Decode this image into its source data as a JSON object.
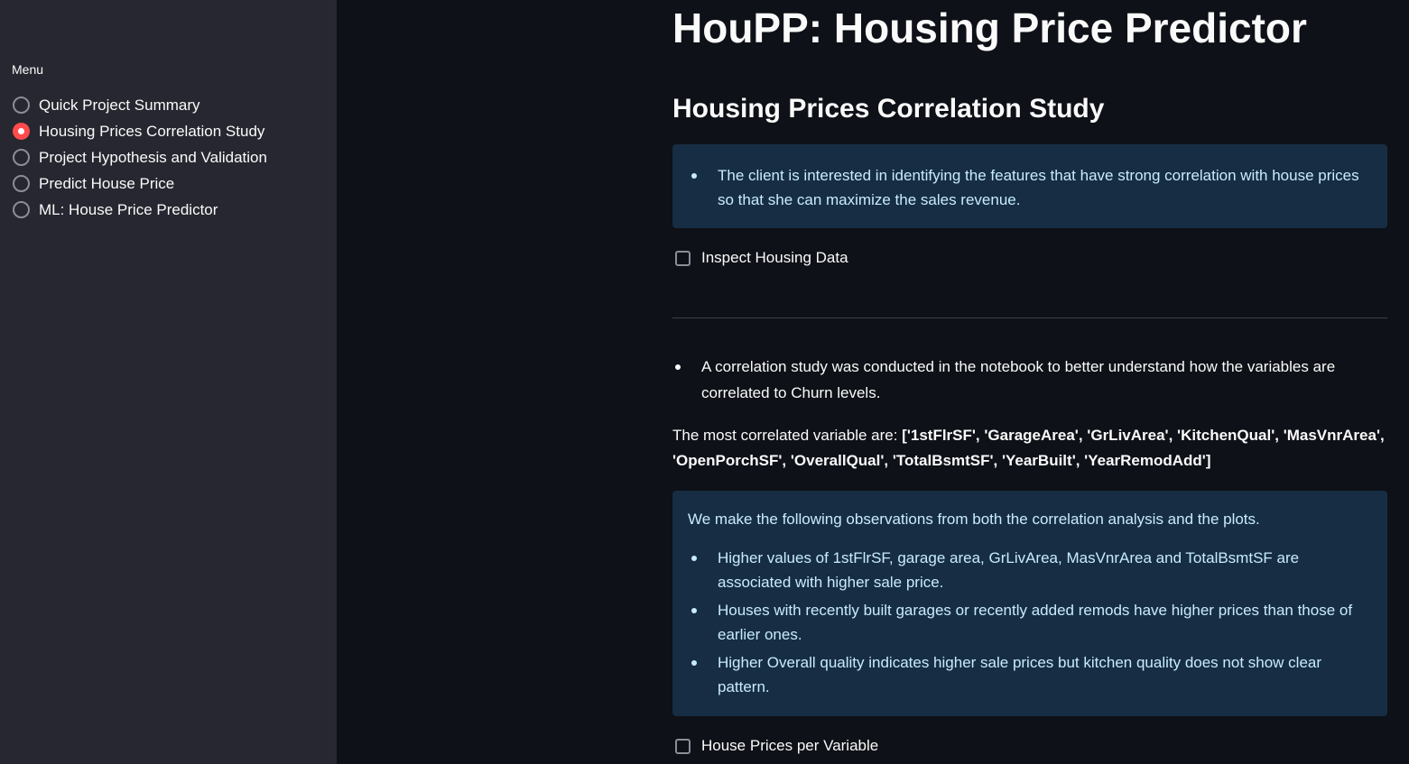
{
  "sidebar": {
    "menu_label": "Menu",
    "items": [
      {
        "label": "Quick Project Summary",
        "selected": false
      },
      {
        "label": "Housing Prices Correlation Study",
        "selected": true
      },
      {
        "label": "Project Hypothesis and Validation",
        "selected": false
      },
      {
        "label": "Predict House Price",
        "selected": false
      },
      {
        "label": "ML: House Price Predictor",
        "selected": false
      }
    ]
  },
  "main": {
    "title": "HouPP: Housing Price Predictor",
    "subtitle": "Housing Prices Correlation Study",
    "client_info": "The client is interested in identifying the features that have strong correlation with house prices so that she can maximize the sales revenue.",
    "inspect_checkbox_label": "Inspect Housing Data",
    "inspect_checked": false,
    "study_bullet": "A correlation study was conducted in the notebook to better understand how the variables are correlated to Churn levels.",
    "corr_prefix": "The most correlated variable are: ",
    "corr_variables": "['1stFlrSF', 'GarageArea', 'GrLivArea', 'KitchenQual', 'MasVnrArea', 'OpenPorchSF', 'OverallQual', 'TotalBsmtSF', 'YearBuilt', 'YearRemodAdd']",
    "observations_intro": "We make the following observations from both the correlation analysis and the plots.",
    "observations": [
      "Higher values of 1stFlrSF, garage area, GrLivArea, MasVnrArea and TotalBsmtSF are associated with higher sale price.",
      "Houses with recently built garages or recently added remods have higher prices than those of earlier ones.",
      "Higher Overall quality indicates higher sale prices but kitchen quality does not show clear pattern."
    ],
    "prices_checkbox_label": "House Prices per Variable",
    "prices_checked": false
  },
  "colors": {
    "sidebar_bg": "#262730",
    "main_bg": "#0e1117",
    "accent": "#ff4b4b",
    "info_bg": "#172d43",
    "info_text": "#c7ebff"
  }
}
